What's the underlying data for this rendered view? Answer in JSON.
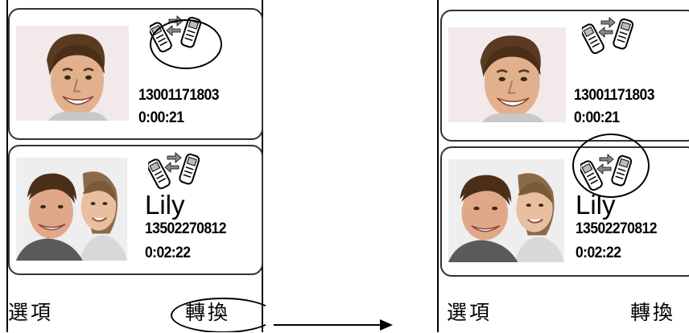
{
  "before": {
    "calls": [
      {
        "number": "13001171803",
        "duration": "0:00:21",
        "photo": "man-portrait",
        "status_icon": "call-transfer-icon-active"
      },
      {
        "name": "Lily",
        "number": "13502270812",
        "duration": "0:02:22",
        "photo": "couple-portrait",
        "status_icon": "call-transfer-icon"
      }
    ],
    "softkeys": {
      "left": "選項",
      "right": "轉換"
    }
  },
  "after": {
    "calls": [
      {
        "number": "13001171803",
        "duration": "0:00:21",
        "photo": "man-portrait",
        "status_icon": "call-transfer-icon"
      },
      {
        "name": "Lily",
        "number": "13502270812",
        "duration": "0:02:22",
        "photo": "couple-portrait",
        "status_icon": "call-transfer-icon-active"
      }
    ],
    "softkeys": {
      "left": "選項",
      "right": "轉換"
    }
  },
  "colors": {
    "ink": "#000000",
    "card_border": "#333333",
    "photo_bg": "#f0e8e8"
  }
}
